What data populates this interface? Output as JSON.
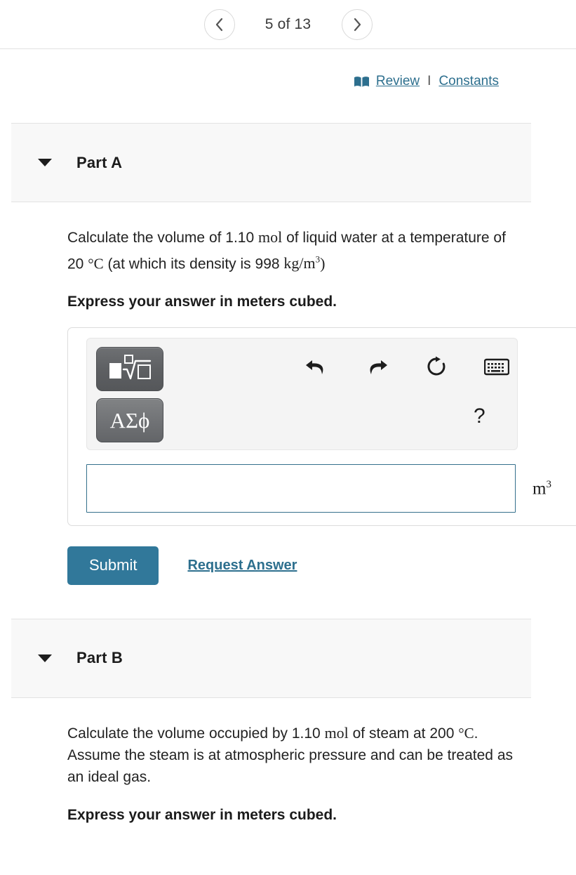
{
  "nav": {
    "prev_icon": "chevron-left-icon",
    "next_icon": "chevron-right-icon",
    "counter": "5 of 13"
  },
  "meta": {
    "book_icon": "book-icon",
    "review_label": "Review",
    "separator": "I",
    "constants_label": "Constants"
  },
  "parts": [
    {
      "id": "a",
      "title": "Part A",
      "caret_icon": "caret-down-icon",
      "question": {
        "seg1": "Calculate the volume of 1.10 ",
        "unit_mol": "mol",
        "seg2": " of liquid water at a temperature of 20 ",
        "unit_degC": "°C",
        "seg3": " (at which its density is 998 ",
        "unit_density": "kg/m",
        "unit_density_sup": "3",
        "seg4": ")"
      },
      "instruction": "Express your answer in meters cubed.",
      "answer": {
        "toolbar": {
          "template_button_icon": "math-template-icon",
          "greek_button_label": "ΑΣϕ",
          "undo_icon": "undo-icon",
          "redo_icon": "redo-icon",
          "reset_icon": "reset-icon",
          "keyboard_icon": "keyboard-icon",
          "help_label": "?"
        },
        "input_value": "",
        "input_placeholder": "",
        "unit_base": "m",
        "unit_sup": "3"
      },
      "submit_label": "Submit",
      "request_answer_label": "Request Answer"
    },
    {
      "id": "b",
      "title": "Part B",
      "caret_icon": "caret-down-icon",
      "question": {
        "seg1": "Calculate the volume occupied by 1.10 ",
        "unit_mol": "mol",
        "seg2": " of steam at 200 ",
        "unit_degC": "°C",
        "seg3": ". Assume the steam is at atmospheric pressure and can be treated as an ideal gas."
      },
      "instruction": "Express your answer in meters cubed."
    }
  ],
  "colors": {
    "accent": "#31789a",
    "link": "#2d6f8e",
    "panel_bg": "#f8f8f8",
    "input_border": "#35708c"
  }
}
